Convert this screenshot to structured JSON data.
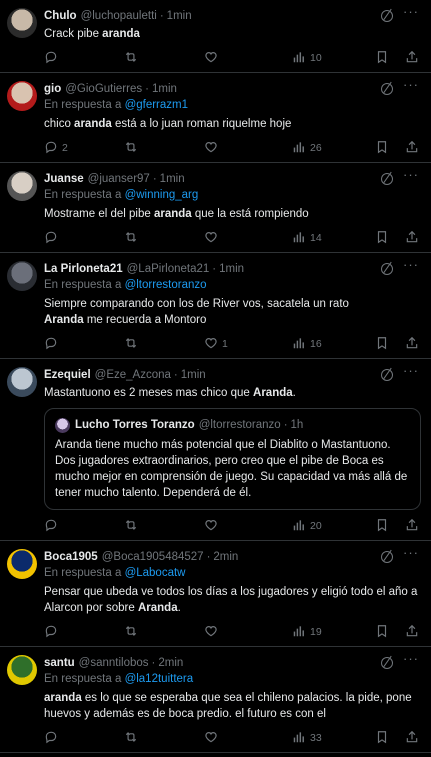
{
  "tweets": [
    {
      "name": "Chulo",
      "handle": "@luchopauletti",
      "time": "1min",
      "reply_to": null,
      "text_parts": [
        {
          "t": "Crack pibe "
        },
        {
          "b": "aranda"
        }
      ],
      "replies": "",
      "retweets": "",
      "likes": "",
      "views": "10",
      "avatar_colors": [
        "#c8b9a8",
        "#2b2b2b"
      ]
    },
    {
      "name": "gio",
      "handle": "@GioGutierres",
      "time": "1min",
      "reply_to": "@gferrazm1",
      "text_parts": [
        {
          "t": "chico "
        },
        {
          "b": "aranda"
        },
        {
          "t": " está a lo juan roman riquelme hoje"
        }
      ],
      "replies": "2",
      "retweets": "",
      "likes": "",
      "views": "26",
      "avatar_colors": [
        "#d9c3b0",
        "#b31b1b"
      ]
    },
    {
      "name": "Juanse",
      "handle": "@juanser97",
      "time": "1min",
      "reply_to": "@winning_arg",
      "text_parts": [
        {
          "t": "Mostrame el del pibe "
        },
        {
          "b": "aranda"
        },
        {
          "t": " que la está rompiendo"
        }
      ],
      "replies": "",
      "retweets": "",
      "likes": "",
      "views": "14",
      "avatar_colors": [
        "#d8cfc5",
        "#555"
      ]
    },
    {
      "name": "La Pirloneta21",
      "handle": "@LaPirloneta21",
      "time": "1min",
      "reply_to": "@ltorrestoranzo",
      "text_lines": [
        [
          {
            "t": "Siempre comparando con los de River vos, sacatela un rato"
          }
        ],
        [
          {
            "b": "Aranda"
          },
          {
            "t": " me recuerda a Montoro"
          }
        ]
      ],
      "replies": "",
      "retweets": "",
      "likes": "1",
      "views": "16",
      "avatar_colors": [
        "#6b6f7a",
        "#2a2d33"
      ]
    },
    {
      "name": "Ezequiel",
      "handle": "@Eze_Azcona",
      "time": "1min",
      "reply_to": null,
      "text_parts": [
        {
          "t": "Mastantuono es 2 meses mas chico que "
        },
        {
          "b": "Aranda"
        },
        {
          "t": "."
        }
      ],
      "quote": {
        "name": "Lucho Torres Toranzo",
        "handle": "@ltorrestoranzo",
        "time": "1h",
        "text": "Aranda tiene mucho más potencial que el Diablito o Mastantuono. Dos jugadores extraordinarios, pero creo que el pibe de Boca es mucho mejor en comprensión de juego. Su capacidad va más allá de tener mucho talento. Dependerá de él."
      },
      "replies": "",
      "retweets": "",
      "likes": "",
      "views": "20",
      "avatar_colors": [
        "#bcc6d1",
        "#3a4a5c"
      ]
    },
    {
      "name": "Boca1905",
      "handle": "@Boca1905484527",
      "time": "2min",
      "reply_to": "@Labocatw",
      "text_parts": [
        {
          "t": "Pensar que ubeda ve todos los días a los jugadores y eligió todo el año a Alarcon por sobre "
        },
        {
          "b": "Aranda"
        },
        {
          "t": "."
        }
      ],
      "replies": "",
      "retweets": "",
      "likes": "",
      "views": "19",
      "avatar_colors": [
        "#0b2a6b",
        "#f2c200"
      ]
    },
    {
      "name": "santu",
      "handle": "@sanntilobos",
      "time": "2min",
      "reply_to": "@la12tuittera",
      "text_parts": [
        {
          "b": "aranda"
        },
        {
          "t": " es lo que se esperaba que sea el chileno palacios. la pide, pone huevos y además es de boca predio. el futuro es con el"
        }
      ],
      "replies": "",
      "retweets": "",
      "likes": "",
      "views": "33",
      "avatar_colors": [
        "#2f6f2a",
        "#e0c800"
      ]
    }
  ],
  "labels": {
    "reply_prefix": "En respuesta a",
    "dot": "·",
    "more": "···"
  },
  "colors": {
    "background": "#000000",
    "text": "#e7e9ea",
    "muted": "#71767b",
    "link": "#1d9bf0",
    "border": "#2f3336"
  }
}
